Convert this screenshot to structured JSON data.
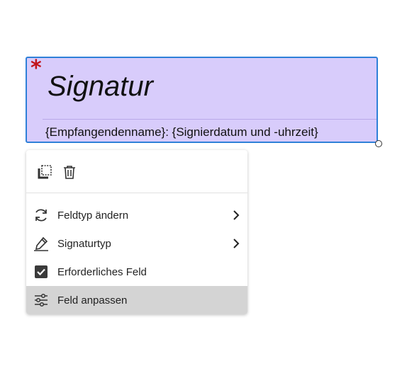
{
  "field": {
    "required_mark": "*",
    "title": "Signatur",
    "caption": "{Empfangendenname}: {Signierdatum und -uhrzeit}"
  },
  "menu": {
    "toolbar": [
      {
        "name": "duplicate-icon"
      },
      {
        "name": "trash-icon"
      }
    ],
    "items": [
      {
        "label": "Feldtyp ändern",
        "icon": "refresh-icon",
        "submenu": true
      },
      {
        "label": "Signaturtyp",
        "icon": "pen-signature-icon",
        "submenu": true
      },
      {
        "label": "Erforderliches Feld",
        "icon": "checkbox-checked-icon",
        "submenu": false
      },
      {
        "label": "Feld anpassen",
        "icon": "sliders-icon",
        "submenu": false,
        "selected": true
      }
    ]
  }
}
